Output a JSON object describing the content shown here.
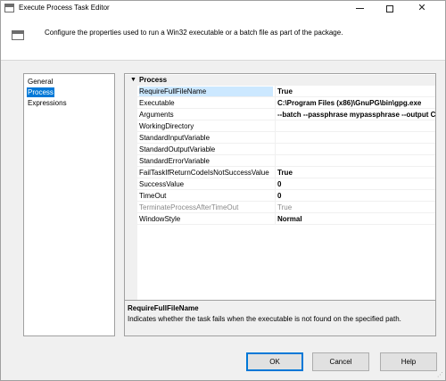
{
  "window": {
    "title": "Execute Process Task Editor"
  },
  "header": {
    "description": "Configure the properties used to run a Win32 executable or a batch file as part of the package."
  },
  "nav": {
    "items": [
      {
        "label": "General",
        "selected": false
      },
      {
        "label": "Process",
        "selected": true
      },
      {
        "label": "Expressions",
        "selected": false
      }
    ]
  },
  "grid": {
    "category": "Process",
    "properties": [
      {
        "name": "RequireFullFileName",
        "value": "True",
        "selected": true,
        "disabled": false
      },
      {
        "name": "Executable",
        "value": "C:\\Program Files (x86)\\GnuPG\\bin\\gpg.exe",
        "selected": false,
        "disabled": false
      },
      {
        "name": "Arguments",
        "value": "--batch --passphrase mypassphrase --output C:\\",
        "selected": false,
        "disabled": false
      },
      {
        "name": "WorkingDirectory",
        "value": "",
        "selected": false,
        "disabled": false
      },
      {
        "name": "StandardInputVariable",
        "value": "",
        "selected": false,
        "disabled": false
      },
      {
        "name": "StandardOutputVariable",
        "value": "",
        "selected": false,
        "disabled": false
      },
      {
        "name": "StandardErrorVariable",
        "value": "",
        "selected": false,
        "disabled": false
      },
      {
        "name": "FailTaskIfReturnCodeIsNotSuccessValue",
        "value": "True",
        "selected": false,
        "disabled": false
      },
      {
        "name": "SuccessValue",
        "value": "0",
        "selected": false,
        "disabled": false
      },
      {
        "name": "TimeOut",
        "value": "0",
        "selected": false,
        "disabled": false
      },
      {
        "name": "TerminateProcessAfterTimeOut",
        "value": "True",
        "selected": false,
        "disabled": true
      },
      {
        "name": "WindowStyle",
        "value": "Normal",
        "selected": false,
        "disabled": false
      }
    ]
  },
  "description_panel": {
    "title": "RequireFullFileName",
    "text": "Indicates whether the task fails when the executable is not found on the specified path."
  },
  "buttons": {
    "ok": "OK",
    "cancel": "Cancel",
    "help": "Help"
  },
  "colors": {
    "selection": "#0078d7",
    "grid_selection": "#cce8ff",
    "dialog_bg": "#f0f0f0"
  }
}
